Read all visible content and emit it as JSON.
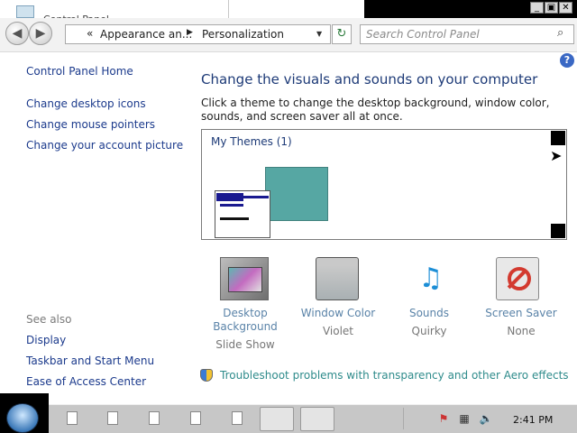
{
  "window": {
    "title": "Control Panel"
  },
  "nav": {
    "back_glyph": "◀",
    "forward_glyph": "▶",
    "breadcrumb_chevron": "«",
    "breadcrumb": [
      "Appearance an...",
      "Personalization"
    ],
    "breadcrumb_arrow": "▶",
    "dropdown_glyph": "▼",
    "refresh_glyph": "↻",
    "search_placeholder": "Search Control Panel",
    "search_glyph": "⌕"
  },
  "caption_buttons": {
    "minimize": "_",
    "maximize": "▣",
    "close": "✕"
  },
  "help": {
    "label": "?"
  },
  "sidebar": {
    "home": "Control Panel Home",
    "tasks": [
      "Change desktop icons",
      "Change mouse pointers",
      "Change your account picture"
    ],
    "see_also_title": "See also",
    "see_also": [
      "Display",
      "Taskbar and Start Menu",
      "Ease of Access Center"
    ]
  },
  "main": {
    "heading": "Change the visuals and sounds on your computer",
    "description": "Click a theme to change the desktop background, window color, sounds, and screen saver all at once.",
    "themes_group": "My Themes (1)",
    "cursor_glyph": "➤"
  },
  "personalize": [
    {
      "title": "Desktop Background",
      "value": "Slide Show",
      "icon": "desktop-background-icon"
    },
    {
      "title": "Window Color",
      "value": "Violet",
      "icon": "window-color-icon"
    },
    {
      "title": "Sounds",
      "value": "Quirky",
      "icon": "sounds-icon",
      "glyph": "♫"
    },
    {
      "title": "Screen Saver",
      "value": "None",
      "icon": "screen-saver-icon"
    }
  ],
  "troubleshoot": "Troubleshoot problems with transparency and other Aero effects",
  "taskbar": {
    "clock": "2:41 PM",
    "tray": [
      "⚑",
      "▦",
      "🔈"
    ]
  },
  "colors": {
    "link": "#1b3a8c",
    "heading": "#1d3a77",
    "theme_bg": "#56a7a3",
    "taskbar": "#c7c7c7"
  }
}
